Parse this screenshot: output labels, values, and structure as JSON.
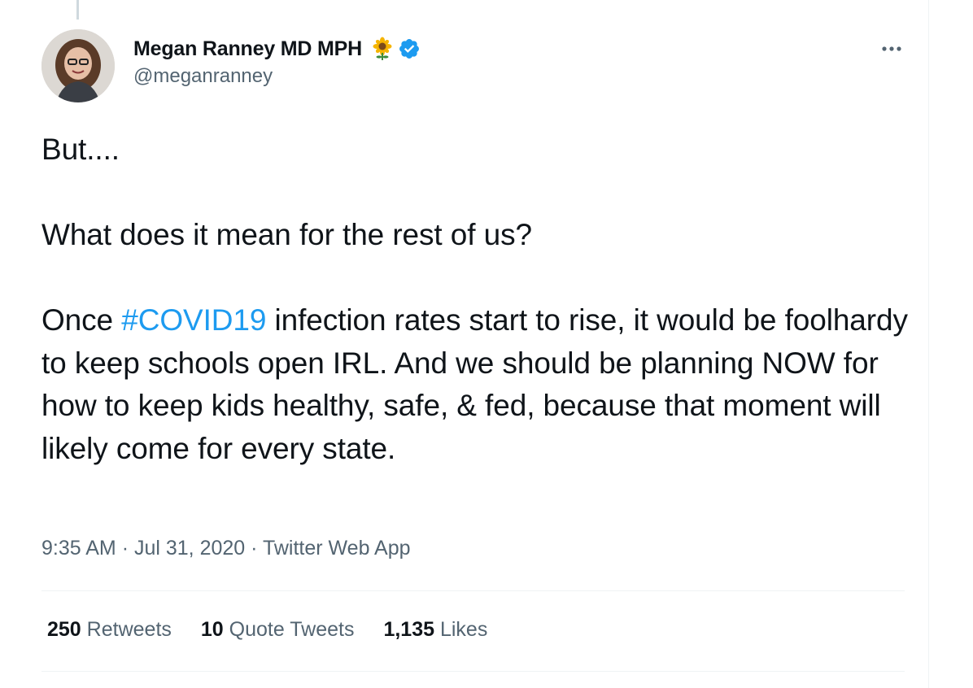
{
  "author": {
    "display_name": "Megan Ranney MD MPH",
    "handle": "@meganranney",
    "name_emoji": "sunflower-emoji",
    "badge_icon": "verified-badge-icon"
  },
  "tweet": {
    "line1": "But....",
    "line2": "What does it mean for the rest of us?",
    "para3_before": "Once ",
    "hashtag": "#COVID19",
    "para3_after": " infection rates start to rise, it would be foolhardy to keep schools open IRL. And we should be planning NOW for how to keep kids healthy, safe, & fed, because that moment will likely come for every state."
  },
  "meta": {
    "time": "9:35 AM",
    "separator": "·",
    "date": "Jul 31, 2020",
    "source": "Twitter Web App"
  },
  "stats": {
    "retweets_count": "250",
    "retweets_label": "Retweets",
    "quotes_count": "10",
    "quotes_label": "Quote Tweets",
    "likes_count": "1,135",
    "likes_label": "Likes"
  },
  "colors": {
    "link": "#1d9bf0",
    "secondary_text": "#536471",
    "primary_text": "#0f1419",
    "divider": "#eff3f4"
  }
}
